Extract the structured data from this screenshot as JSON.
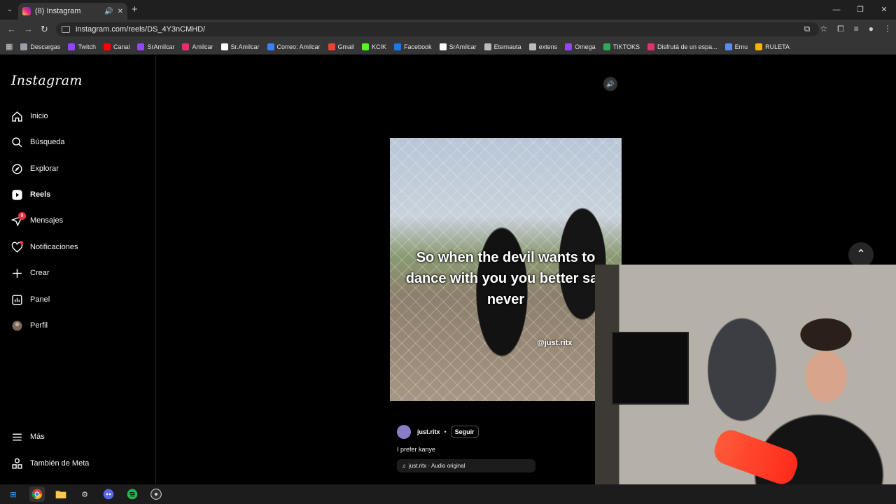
{
  "browser": {
    "tab_title": "(8) Instagram",
    "url": "instagram.com/reels/DS_4Y3nCMHD/",
    "bookmarks": [
      {
        "label": "Descargas",
        "color": "#9aa0a6"
      },
      {
        "label": "Twitch",
        "color": "#9146ff"
      },
      {
        "label": "Canal",
        "color": "#ff0000"
      },
      {
        "label": "SrAmilcar",
        "color": "#9146ff"
      },
      {
        "label": "Amilcar",
        "color": "#e1306c"
      },
      {
        "label": "Sr.Amilcar",
        "color": "#ffffff"
      },
      {
        "label": "Correo: Amilcar",
        "color": "#3b82f6"
      },
      {
        "label": "Gmail",
        "color": "#ea4335"
      },
      {
        "label": "KCIK",
        "color": "#53fc18"
      },
      {
        "label": "Facebook",
        "color": "#1877f2"
      },
      {
        "label": "SrAmilcar",
        "color": "#ffffff"
      },
      {
        "label": "Eternauta",
        "color": "#bbbbbb"
      },
      {
        "label": "extens",
        "color": "#bbbbbb"
      },
      {
        "label": "Omega",
        "color": "#9146ff"
      },
      {
        "label": "TIKTOKS",
        "color": "#34a853"
      },
      {
        "label": "Disfrutá de un espa...",
        "color": "#e1306c"
      },
      {
        "label": "Emu",
        "color": "#5b8def"
      },
      {
        "label": "RULETA",
        "color": "#f4b400"
      }
    ]
  },
  "sidebar": {
    "logo": "Instagram",
    "items": [
      {
        "label": "Inicio",
        "icon": "home-icon"
      },
      {
        "label": "Búsqueda",
        "icon": "search-icon"
      },
      {
        "label": "Explorar",
        "icon": "compass-icon"
      },
      {
        "label": "Reels",
        "icon": "reels-icon"
      },
      {
        "label": "Mensajes",
        "icon": "messages-icon",
        "badge": "8"
      },
      {
        "label": "Notificaciones",
        "icon": "heart-icon"
      },
      {
        "label": "Crear",
        "icon": "plus-icon"
      },
      {
        "label": "Panel",
        "icon": "chart-icon"
      },
      {
        "label": "Perfil",
        "icon": "avatar"
      }
    ],
    "more": "Más",
    "meta": "También de Meta"
  },
  "reel": {
    "caption_overlay": "So when the devil wants to dance with you you better say never",
    "watermark": "@just.ritx",
    "username": "just.ritx",
    "separator": "•",
    "follow": "Seguir",
    "description": "I prefer kanye",
    "audio": "just.ritx · Audio original"
  }
}
